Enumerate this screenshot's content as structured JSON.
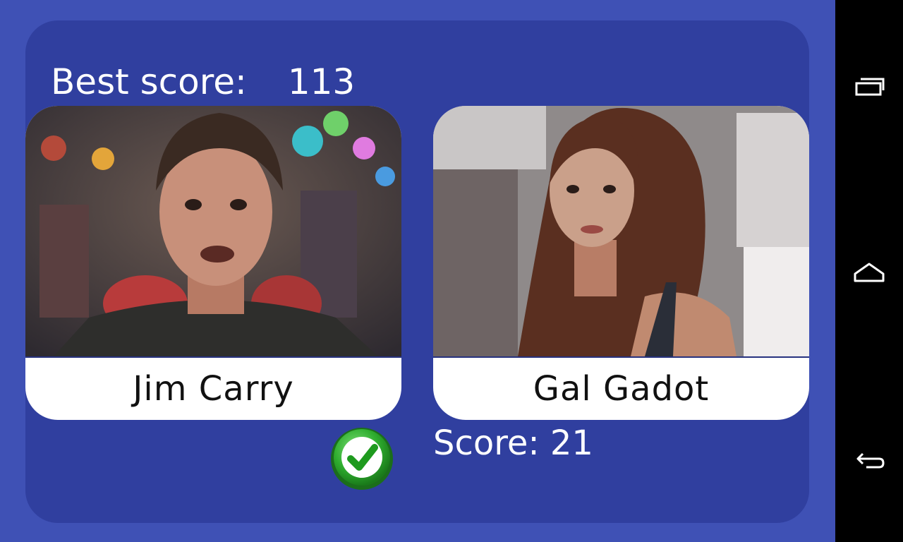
{
  "game": {
    "best_score_label": "Best score:",
    "best_score_value": "113",
    "score_label": "Score: 21"
  },
  "cards": [
    {
      "name": "Jim Carry",
      "photo_description_icon": "portrait-photo"
    },
    {
      "name": "Gal Gadot",
      "photo_description_icon": "portrait-photo"
    }
  ],
  "result_icon": "checkmark-icon",
  "colors": {
    "background": "#3f51b5",
    "panel": "#303f9f",
    "card": "#ffffff",
    "check_green": "#2fae2f",
    "navbar": "#000000"
  },
  "navbar": {
    "recents_icon": "recent-apps-icon",
    "home_icon": "home-icon",
    "back_icon": "back-icon"
  }
}
